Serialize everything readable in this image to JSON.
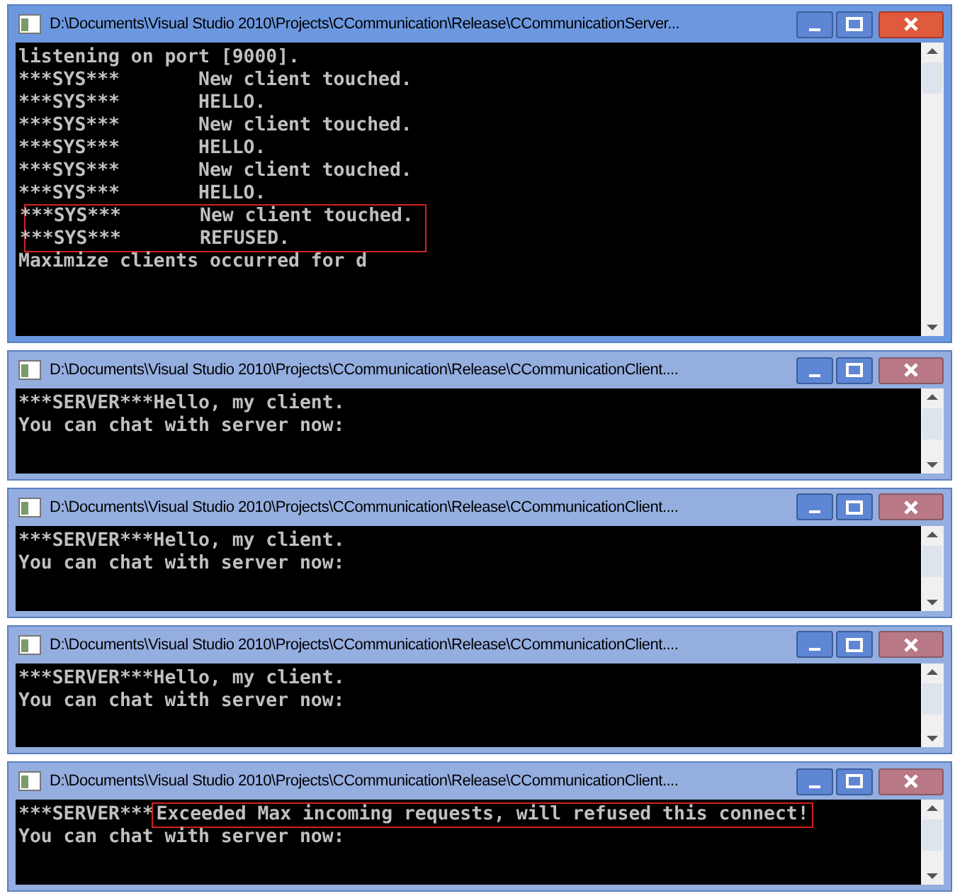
{
  "windows": [
    {
      "title": "D:\\Documents\\Visual Studio 2010\\Projects\\CCommunication\\Release\\CCommunicationServer...",
      "active": true,
      "kind": "server",
      "lines": [
        {
          "text": "listening on port [9000].",
          "highlighted": false
        },
        {
          "tag": "***SYS***",
          "text": "New client touched.",
          "highlighted": false
        },
        {
          "tag": "***SYS***",
          "text": "HELLO.",
          "highlighted": false
        },
        {
          "tag": "***SYS***",
          "text": "New client touched.",
          "highlighted": false
        },
        {
          "tag": "***SYS***",
          "text": "HELLO.",
          "highlighted": false
        },
        {
          "tag": "***SYS***",
          "text": "New client touched.",
          "highlighted": false
        },
        {
          "tag": "***SYS***",
          "text": "HELLO.",
          "highlighted": false
        },
        {
          "tag": "***SYS***",
          "text": "New client touched.",
          "highlighted": true
        },
        {
          "tag": "***SYS***",
          "text": "REFUSED.",
          "highlighted": true
        },
        {
          "text": "Maximize clients occurred for d",
          "highlighted": false
        }
      ]
    },
    {
      "title": "D:\\Documents\\Visual Studio 2010\\Projects\\CCommunication\\Release\\CCommunicationClient....",
      "active": false,
      "kind": "client",
      "lines": [
        {
          "tag": "***SERVER***",
          "text": "Hello, my client.",
          "highlighted": false
        },
        {
          "text": "You can chat with server now:",
          "highlighted": false
        }
      ]
    },
    {
      "title": "D:\\Documents\\Visual Studio 2010\\Projects\\CCommunication\\Release\\CCommunicationClient....",
      "active": false,
      "kind": "client",
      "lines": [
        {
          "tag": "***SERVER***",
          "text": "Hello, my client.",
          "highlighted": false
        },
        {
          "text": "You can chat with server now:",
          "highlighted": false
        }
      ]
    },
    {
      "title": "D:\\Documents\\Visual Studio 2010\\Projects\\CCommunication\\Release\\CCommunicationClient....",
      "active": false,
      "kind": "client",
      "lines": [
        {
          "tag": "***SERVER***",
          "text": "Hello, my client.",
          "highlighted": false
        },
        {
          "text": "You can chat with server now:",
          "highlighted": false
        }
      ]
    },
    {
      "title": "D:\\Documents\\Visual Studio 2010\\Projects\\CCommunication\\Release\\CCommunicationClient....",
      "active": false,
      "kind": "client",
      "lines": [
        {
          "tag": "***SERVER***",
          "text": "Exceeded Max incoming requests, will refused this connect!",
          "highlighted": true
        },
        {
          "text": "You can chat with server now:",
          "highlighted": false
        }
      ]
    }
  ]
}
